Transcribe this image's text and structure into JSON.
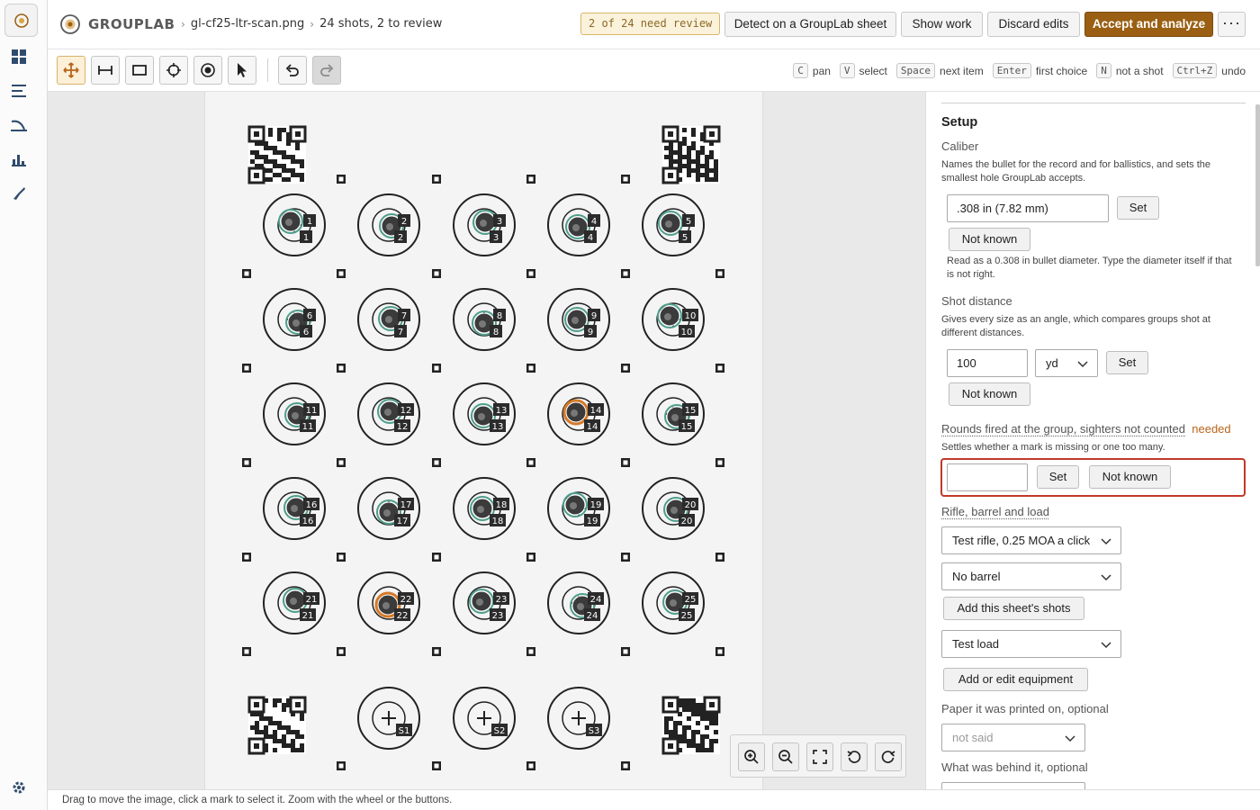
{
  "app": {
    "brand": "GROUPLAB",
    "breadcrumb": [
      "gl-cf25-ltr-scan.png",
      "24 shots, 2 to review"
    ],
    "review_badge": "2 of 24 need review",
    "buttons": {
      "detect": "Detect on a GroupLab sheet",
      "show_work": "Show work",
      "discard": "Discard edits",
      "accept": "Accept and analyze",
      "more": "···"
    },
    "accent": "#9a5f13"
  },
  "rail": {
    "icons": [
      "grouplab-logo-icon",
      "dashboard-icon",
      "list-icon",
      "curve-icon",
      "chart-icon",
      "rifle-icon",
      "settings-icon"
    ]
  },
  "toolbar": {
    "tools": [
      "pan-tool",
      "measure-tool",
      "rectangle-tool",
      "crosshair-tool",
      "target-tool",
      "select-tool"
    ],
    "hints": [
      {
        "key": "C",
        "label": "pan"
      },
      {
        "key": "V",
        "label": "select"
      },
      {
        "key": "Space",
        "label": "next item"
      },
      {
        "key": "Enter",
        "label": "first choice"
      },
      {
        "key": "N",
        "label": "not a shot"
      },
      {
        "key": "Ctrl+Z",
        "label": "undo"
      }
    ]
  },
  "sheet": {
    "targets": [
      {
        "label": "1"
      },
      {
        "label": "2"
      },
      {
        "label": "3"
      },
      {
        "label": "4"
      },
      {
        "label": "5"
      },
      {
        "label": "6"
      },
      {
        "label": "7"
      },
      {
        "label": "8"
      },
      {
        "label": "9"
      },
      {
        "label": "10"
      },
      {
        "label": "11"
      },
      {
        "label": "12"
      },
      {
        "label": "13"
      },
      {
        "label": "14",
        "review": true
      },
      {
        "label": "15"
      },
      {
        "label": "16"
      },
      {
        "label": "17"
      },
      {
        "label": "18"
      },
      {
        "label": "19"
      },
      {
        "label": "20"
      },
      {
        "label": "21"
      },
      {
        "label": "22",
        "review": true
      },
      {
        "label": "23"
      },
      {
        "label": "24"
      },
      {
        "label": "25"
      }
    ],
    "sighters": [
      "S1",
      "S2",
      "S3"
    ]
  },
  "panel": {
    "title": "Setup",
    "caliber": {
      "label": "Caliber",
      "desc": "Names the bullet for the record and for ballistics, and sets the smallest hole GroupLab accepts.",
      "value": ".308 in (7.82 mm)",
      "set": "Set",
      "not_known": "Not known",
      "note": "Read as a 0.308 in bullet diameter. Type the diameter itself if that is not right."
    },
    "distance": {
      "label": "Shot distance",
      "desc": "Gives every size as an angle, which compares groups shot at different distances.",
      "value": "100",
      "unit": "yd",
      "set": "Set",
      "not_known": "Not known"
    },
    "rounds": {
      "label": "Rounds fired at the group, sighters not counted",
      "needed": "needed",
      "desc": "Settles whether a mark is missing or one too many.",
      "value": "",
      "set": "Set",
      "not_known": "Not known"
    },
    "equipment": {
      "label": "Rifle, barrel and load",
      "rifle": "Test rifle, 0.25 MOA a click",
      "barrel": "No barrel",
      "add_shots": "Add this sheet's shots",
      "load": "Test load",
      "edit": "Add or edit equipment"
    },
    "paper": {
      "label": "Paper it was printed on, optional",
      "value": "not said"
    },
    "behind": {
      "label": "What was behind it, optional"
    }
  },
  "status": "Drag to move the image, click a mark to select it. Zoom with the wheel or the buttons."
}
